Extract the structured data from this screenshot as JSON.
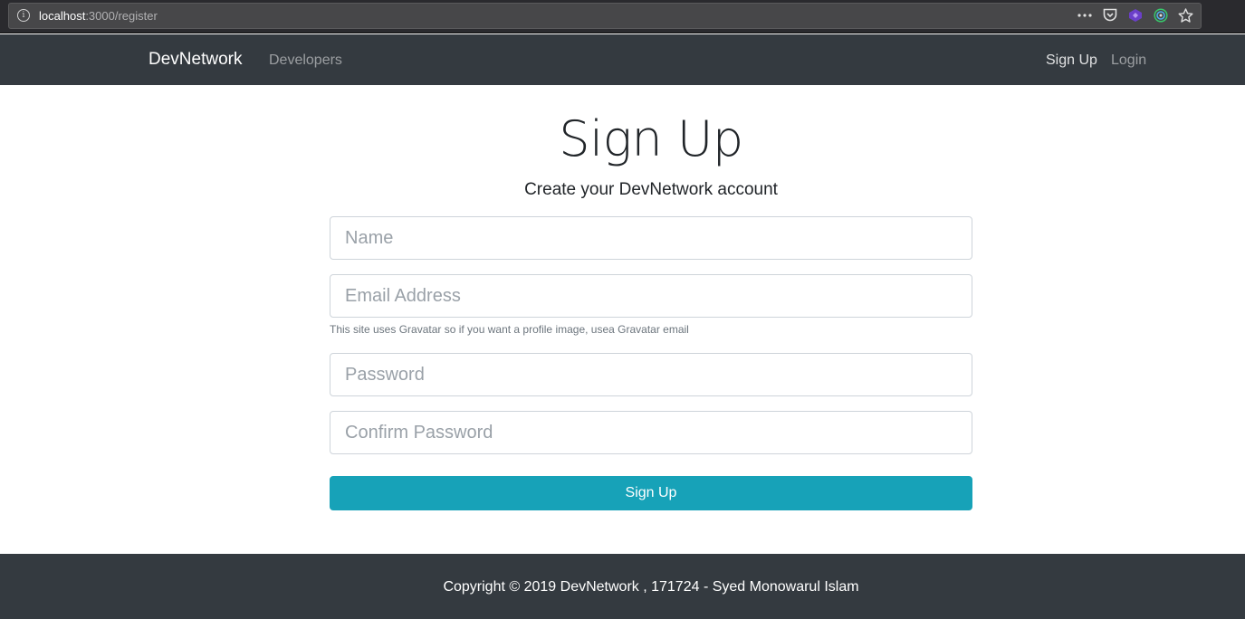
{
  "browser": {
    "url_host": "localhost",
    "url_path": ":3000/register",
    "icons": [
      "more-icon",
      "pocket-icon",
      "extension-icon",
      "target-extension-icon",
      "bookmark-star-icon"
    ]
  },
  "navbar": {
    "brand": "DevNetwork",
    "developers": "Developers",
    "signup": "Sign Up",
    "login": "Login"
  },
  "main": {
    "title": "Sign Up",
    "subtitle": "Create your DevNetwork account",
    "name_placeholder": "Name",
    "email_placeholder": "Email Address",
    "email_help": "This site uses Gravatar so if you want a profile image, usea Gravatar email",
    "password_placeholder": "Password",
    "confirm_placeholder": "Confirm Password",
    "submit_label": "Sign Up"
  },
  "footer": {
    "text": "Copyright © 2019 DevNetwork , 171724 - Syed Monowarul Islam"
  },
  "colors": {
    "navbar_bg": "#343a40",
    "button_bg": "#17a2b8",
    "page_bg": "#ffffff"
  }
}
